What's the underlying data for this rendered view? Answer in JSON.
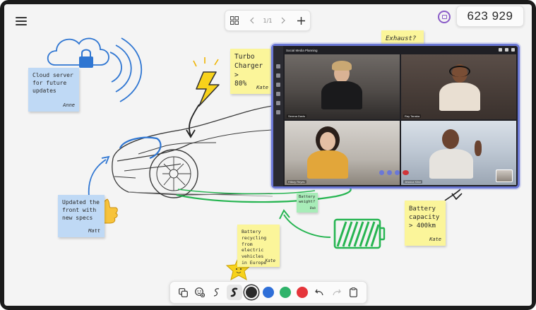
{
  "header": {
    "page_count": "1/1",
    "session_code": "623 929"
  },
  "notes": {
    "cloud": {
      "lines": [
        "Cloud server",
        "for future",
        "updates"
      ],
      "author": "Anne"
    },
    "turbo": {
      "lines": [
        "Turbo",
        "Charger >",
        "80%"
      ],
      "author": "Kate"
    },
    "front": {
      "lines": [
        "Updated the",
        "front with",
        "new specs"
      ],
      "author": "Matt"
    },
    "recycle": {
      "lines": [
        "Battery",
        "recycling from",
        "electric vehicles",
        "in Europe"
      ],
      "author": "Kate"
    },
    "weight": {
      "lines": [
        "Battery",
        "weight?"
      ],
      "author": "Bob"
    },
    "capacity": {
      "lines": [
        "Battery",
        "capacity",
        "> 400km"
      ],
      "author": "Kate"
    },
    "partial": {
      "text": "Exhaust?"
    }
  },
  "call": {
    "title": "Social Media Planning",
    "participants": [
      {
        "name": "Serena Davis"
      },
      {
        "name": "Ray Tanaka"
      },
      {
        "name": "Hillary Reyes"
      },
      {
        "name": "Jessica Kline"
      }
    ]
  },
  "toolbar": {
    "tools": [
      "copy-icon",
      "sticker-icon",
      "pen-thin-icon",
      "pen-thick-icon"
    ],
    "colors": [
      "#2b2b2b",
      "#2f6fd8",
      "#2fb36a",
      "#e5353b"
    ],
    "selected_color": "#2b2b2b"
  },
  "accents": {
    "call_border": "#6b78d6",
    "cast_icon": "#8a5cc7",
    "sketch_blue": "#2f76d2",
    "battery_green": "#27b552"
  }
}
